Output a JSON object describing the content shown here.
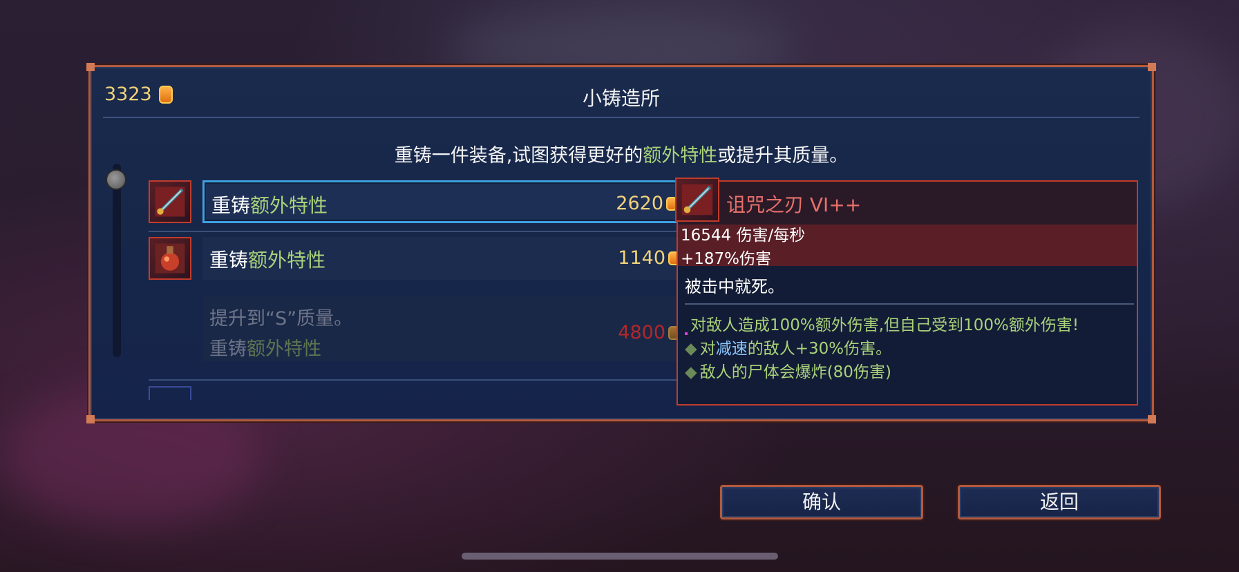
{
  "gold": "3323",
  "title": "小铸造所",
  "subtitle": {
    "part1": "重铸一件装备,试图获得更好的",
    "highlight": "额外特性",
    "part2": "或提升其质量。"
  },
  "rows": [
    {
      "label_a": "重铸",
      "label_b": "额外特性",
      "price": "2620",
      "selected": true
    },
    {
      "label_a": "重铸",
      "label_b": "额外特性",
      "price": "1140",
      "selected": false
    },
    {
      "line1": "提升到“S”质量。",
      "line2_a": "重铸",
      "line2_b": "额外特性",
      "price": "4800",
      "disabled": true
    }
  ],
  "tooltip": {
    "name": "诅咒之刃 VI++",
    "stat1": "16544 伤害/每秒",
    "stat2": "+187%伤害",
    "desc": "被击中就死。",
    "affixes": [
      {
        "text": "对敌人造成100%额外伤害,但自己受到100%额外伤害!"
      },
      {
        "a": "对",
        "b": "减速",
        "c": "的敌人+30%伤害。"
      },
      {
        "text": "敌人的尸体会爆炸(80伤害)"
      }
    ]
  },
  "buttons": {
    "confirm": "确认",
    "back": "返回"
  },
  "icons": {
    "item1": "cursed-sword-icon",
    "item2": "potion-bomb-icon",
    "coin": "gold-coin-icon"
  },
  "colors": {
    "accent_green": "#a9d27a",
    "gold": "#f0d27a",
    "frame": "#b35a3e",
    "name_red": "#e8706a"
  }
}
